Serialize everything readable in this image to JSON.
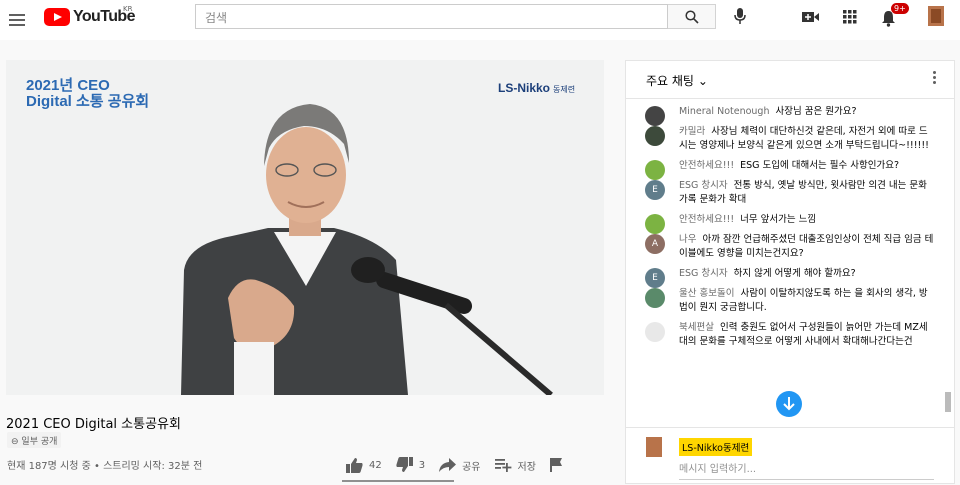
{
  "masthead": {
    "logo_text": "YouTube",
    "country_code": "KR",
    "search_placeholder": "검색",
    "notification_count": "9+"
  },
  "video": {
    "overlay_title": "2021년 CEO\nDigital 소통 공유회",
    "overlay_logo": "LS-Nikko",
    "overlay_logo_korean": "동제련",
    "title": "2021 CEO Digital 소통공유회",
    "visibility": "일부 공개",
    "stats": "현재 187명 시청 중 • 스트리밍 시작: 32분 전",
    "likes": "42",
    "dislikes": "3",
    "share": "공유",
    "save": "저장"
  },
  "chat": {
    "header": "주요 채팅",
    "messages": [
      {
        "author": "Mineral Notenough",
        "text": "사장님 꿈은 뭔가요?",
        "avatar": "",
        "color": "#444444"
      },
      {
        "author": "카밀라",
        "text": "사장님 체력이 대단하신것 같은데, 자전거 외에 따로 드시는 영양제나 보양식 같은게 있으면 소개 부탁드립니다~!!!!!!",
        "avatar": "",
        "color": "#3d4a3b"
      },
      {
        "author": "안전하세요!!!",
        "text": "ESG 도입에 대해서는 필수 사항인가요?",
        "avatar": "",
        "color": "#7cb342"
      },
      {
        "author": "ESG 창시자",
        "text": "전통 방식, 옛날 방식만, 윗사람만 의견 내는 문화가록 문화가 확대",
        "avatar": "E",
        "color": "#607d8b"
      },
      {
        "author": "안전하세요!!!",
        "text": "너무 앞서가는 느낌",
        "avatar": "",
        "color": "#7cb342"
      },
      {
        "author": "나우",
        "text": "아까 잠깐 언급해주셨던 대출조임인상이 전체 직급 임금 테이블에도 영향을 미치는건지요?",
        "avatar": "A",
        "color": "#8d6e63"
      },
      {
        "author": "ESG 창시자",
        "text": "하지 않게 어떻게 해야 할까요?",
        "avatar": "E",
        "color": "#607d8b"
      },
      {
        "author": "울산 홍보돌이",
        "text": "사람이 이탈하지않도록 하는 을 회사의 생각, 방법이 뭔지 궁금합니다.",
        "avatar": "",
        "color": "#5a8a6a"
      },
      {
        "author": "북세편살",
        "text": "인력 충원도 없어서 구성원들이 늙어만 가는데 MZ세대의 문화를 구체적으로 어떻게 사내에서 확대해나간다는건",
        "avatar": "",
        "color": "#e8e8e8"
      }
    ],
    "input_user": "LS-Nikko동제련",
    "input_placeholder": "메시지 입력하기..."
  }
}
